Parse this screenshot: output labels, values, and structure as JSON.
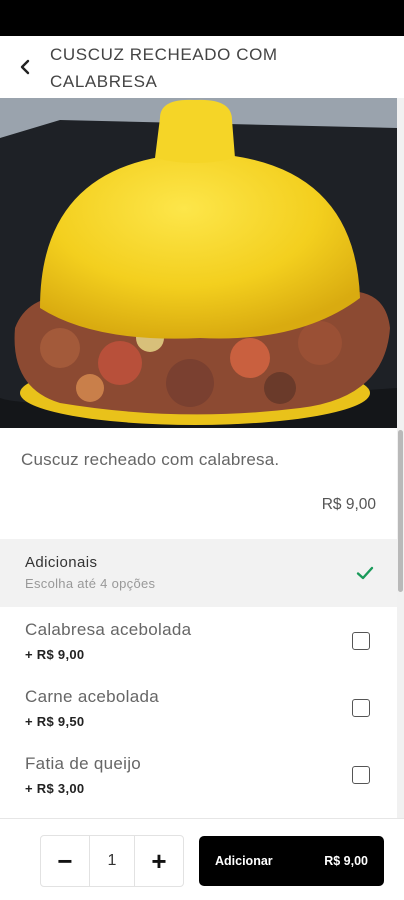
{
  "header": {
    "title": "CUSCUZ RECHEADO COM CALABRESA",
    "back_icon": "chevron-left-icon"
  },
  "product": {
    "description": "Cuscuz recheado com calabresa.",
    "price": "R$ 9,00"
  },
  "addons": {
    "title": "Adicionais",
    "subtitle": "Escolha até 4 opções",
    "check_icon": "check-icon",
    "check_color": "#1a9a5a",
    "options": [
      {
        "name": "Calabresa acebolada",
        "price": "+ R$ 9,00",
        "checked": false
      },
      {
        "name": "Carne acebolada",
        "price": "+ R$ 9,50",
        "checked": false
      },
      {
        "name": "Fatia de queijo",
        "price": "+ R$ 3,00",
        "checked": false
      }
    ]
  },
  "footer": {
    "minus": "−",
    "quantity": "1",
    "plus": "+",
    "add_label": "Adicionar",
    "add_price": "R$ 9,00"
  }
}
